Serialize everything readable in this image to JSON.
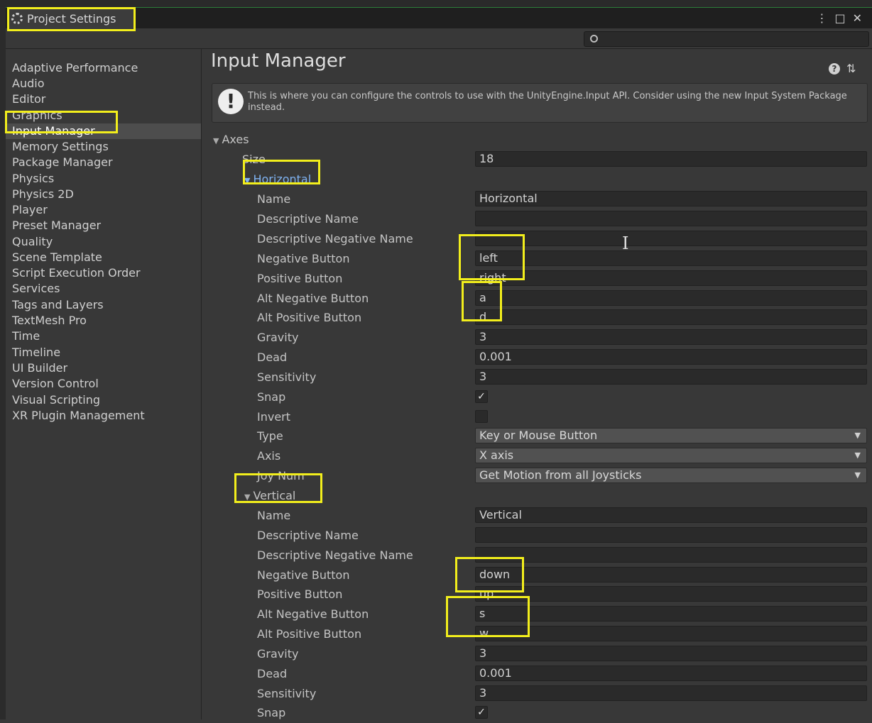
{
  "window": {
    "title": "Project Settings",
    "search": {
      "value": "",
      "placeholder": ""
    }
  },
  "sidebar": {
    "items": [
      {
        "label": "Adaptive Performance"
      },
      {
        "label": "Audio"
      },
      {
        "label": "Editor"
      },
      {
        "label": "Graphics"
      },
      {
        "label": "Input Manager",
        "selected": true
      },
      {
        "label": "Memory Settings"
      },
      {
        "label": "Package Manager"
      },
      {
        "label": "Physics"
      },
      {
        "label": "Physics 2D"
      },
      {
        "label": "Player"
      },
      {
        "label": "Preset Manager"
      },
      {
        "label": "Quality"
      },
      {
        "label": "Scene Template"
      },
      {
        "label": "Script Execution Order"
      },
      {
        "label": "Services"
      },
      {
        "label": "Tags and Layers"
      },
      {
        "label": "TextMesh Pro"
      },
      {
        "label": "Time"
      },
      {
        "label": "Timeline"
      },
      {
        "label": "UI Builder"
      },
      {
        "label": "Version Control"
      },
      {
        "label": "Visual Scripting"
      },
      {
        "label": "XR Plugin Management"
      }
    ]
  },
  "main": {
    "title": "Input Manager",
    "helpbox": "This is where you can configure the controls to use with the UnityEngine.Input API. Consider using the new Input System Package instead.",
    "axes_label": "Axes",
    "size_label": "Size",
    "size_value": "18",
    "horizontal": {
      "label": "Horizontal",
      "name_label": "Name",
      "name": "Horizontal",
      "desc_label": "Descriptive Name",
      "desc": "",
      "desc_neg_label": "Descriptive Negative Name",
      "desc_neg": "",
      "neg_label": "Negative Button",
      "neg": "left",
      "pos_label": "Positive Button",
      "pos": "right",
      "alt_neg_label": "Alt Negative Button",
      "alt_neg": "a",
      "alt_pos_label": "Alt Positive Button",
      "alt_pos": "d",
      "gravity_label": "Gravity",
      "gravity": "3",
      "dead_label": "Dead",
      "dead": "0.001",
      "sensitivity_label": "Sensitivity",
      "sensitivity": "3",
      "snap_label": "Snap",
      "snap": true,
      "invert_label": "Invert",
      "invert": false,
      "type_label": "Type",
      "type": "Key or Mouse Button",
      "axis_label": "Axis",
      "axis": "X axis",
      "joy_label": "Joy Num",
      "joy": "Get Motion from all Joysticks"
    },
    "vertical": {
      "label": "Vertical",
      "name_label": "Name",
      "name": "Vertical",
      "desc_label": "Descriptive Name",
      "desc": "",
      "desc_neg_label": "Descriptive Negative Name",
      "desc_neg": "",
      "neg_label": "Negative Button",
      "neg": "down",
      "pos_label": "Positive Button",
      "pos": "up",
      "alt_neg_label": "Alt Negative Button",
      "alt_neg": "s",
      "alt_pos_label": "Alt Positive Button",
      "alt_pos": "w",
      "gravity_label": "Gravity",
      "gravity": "3",
      "dead_label": "Dead",
      "dead": "0.001",
      "sensitivity_label": "Sensitivity",
      "sensitivity": "3",
      "snap_label": "Snap",
      "snap": true
    }
  },
  "icons": {
    "tab": "gear-icon",
    "window_menu": "kebab-menu-icon",
    "window_maximize": "maximize-icon",
    "window_close": "close-icon",
    "search": "search-icon",
    "help": "help-icon",
    "presets": "presets-icon",
    "warning": "warning-icon",
    "checkbox": "checkmark-icon"
  },
  "colors": {
    "highlight": "#f2ee1c",
    "selected_foldout": "#7fb2f0",
    "panel": "#383838",
    "field": "#2a2a2a"
  }
}
